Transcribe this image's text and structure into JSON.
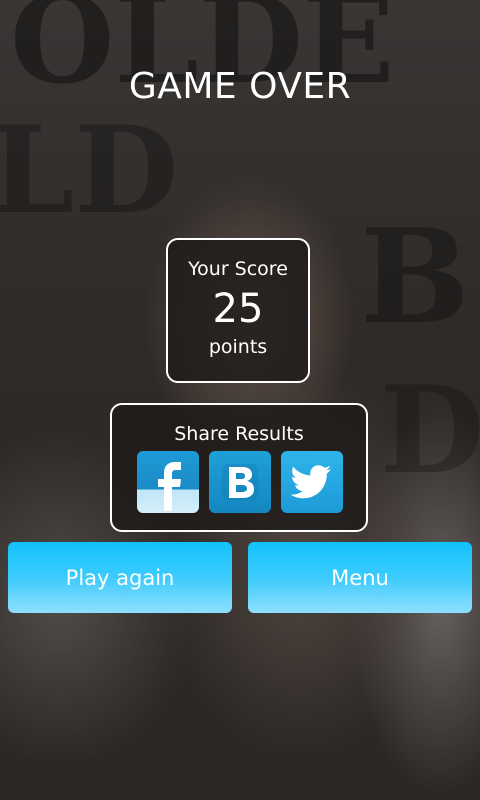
{
  "header": {
    "title": "GAME OVER"
  },
  "score": {
    "label": "Your Score",
    "value": "25",
    "unit": "points"
  },
  "share": {
    "label": "Share Results",
    "services": [
      {
        "name": "facebook",
        "icon": "facebook-icon"
      },
      {
        "name": "vkontakte",
        "icon": "vk-icon"
      },
      {
        "name": "twitter",
        "icon": "twitter-icon"
      }
    ]
  },
  "actions": {
    "play_again": "Play again",
    "menu": "Menu"
  },
  "colors": {
    "button": "#12c2fb",
    "box_border": "#ffffff",
    "text": "#ffffff"
  }
}
